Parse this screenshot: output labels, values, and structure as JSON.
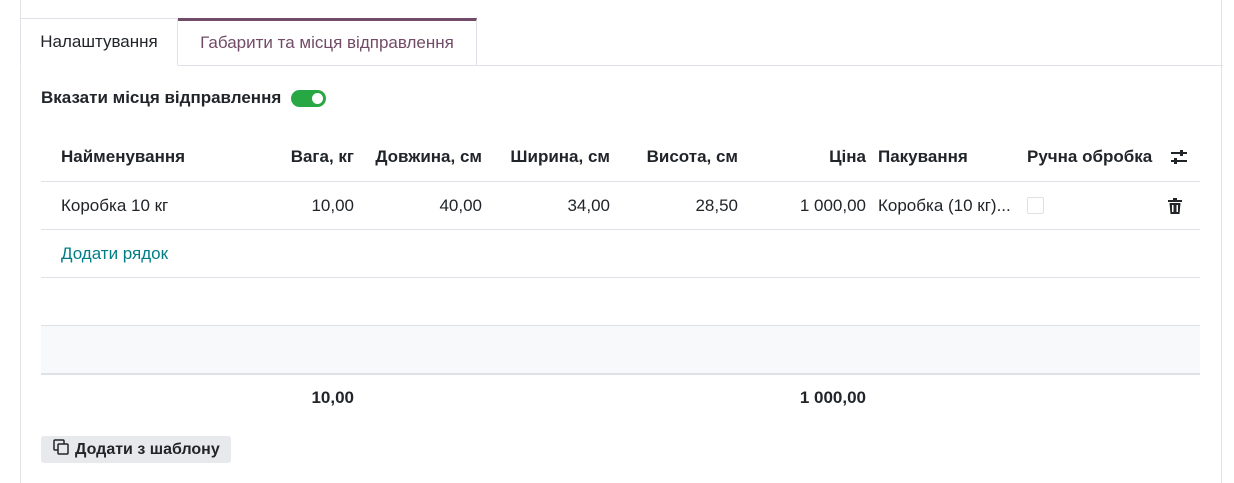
{
  "tabs": [
    {
      "label": "Налаштування"
    },
    {
      "label": "Габарити та місця відправлення"
    }
  ],
  "toggle": {
    "label": "Вказати місця відправлення",
    "checked": true,
    "color": "#28a745"
  },
  "table": {
    "headers": {
      "name": "Найменування",
      "weight": "Вага, кг",
      "length": "Довжина, см",
      "width": "Ширина, см",
      "height": "Висота, см",
      "price": "Ціна",
      "packaging": "Пакування",
      "manual": "Ручна обробка"
    },
    "rows": [
      {
        "name": "Коробка 10 кг",
        "weight": "10,00",
        "length": "40,00",
        "width": "34,00",
        "height": "28,50",
        "price": "1 000,00",
        "packaging": "Коробка (10 кг)...",
        "manual": false
      }
    ],
    "add_line": "Додати рядок",
    "totals": {
      "weight": "10,00",
      "price": "1 000,00"
    }
  },
  "template_button": {
    "label": "Додати з шаблону"
  },
  "colors": {
    "accent": "#714b67",
    "link": "#017e84",
    "toggle_on": "#28a745"
  }
}
